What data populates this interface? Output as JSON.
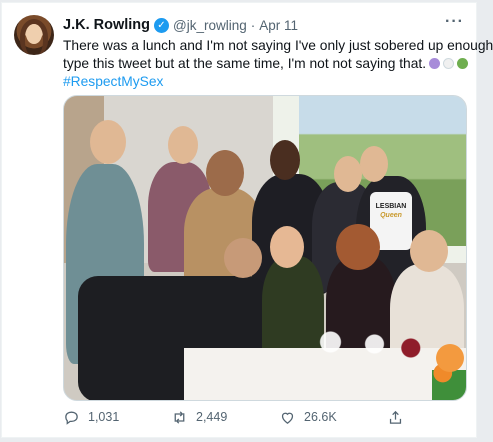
{
  "tweet": {
    "author_name": "J.K. Rowling",
    "handle": "@jk_rowling",
    "separator": "·",
    "date": "Apr 11",
    "more_label": "···",
    "verified_mark": "✓",
    "text_line_1": "There was a lunch and I'm not saying I've only just sobered up enough to",
    "text_line_2": "type this tweet but at the same time, I'm not not saying that.",
    "emoji": [
      "purple-heart",
      "white-heart",
      "green-heart"
    ],
    "hashtag": "#RespectMySex",
    "photo_alt": "",
    "photo_shirt_text_1": "LESBIAN",
    "photo_shirt_text_2": "Queen"
  },
  "actions": {
    "reply_count": "1,031",
    "retweet_count": "2,449",
    "like_count": "26.6K"
  },
  "colors": {
    "accent": "#1d9bf0",
    "text_primary": "#0f1419",
    "text_secondary": "#536471",
    "heart_purple": "#a78bd9",
    "heart_white": "#f0f0f0",
    "heart_green": "#6fae4f"
  }
}
